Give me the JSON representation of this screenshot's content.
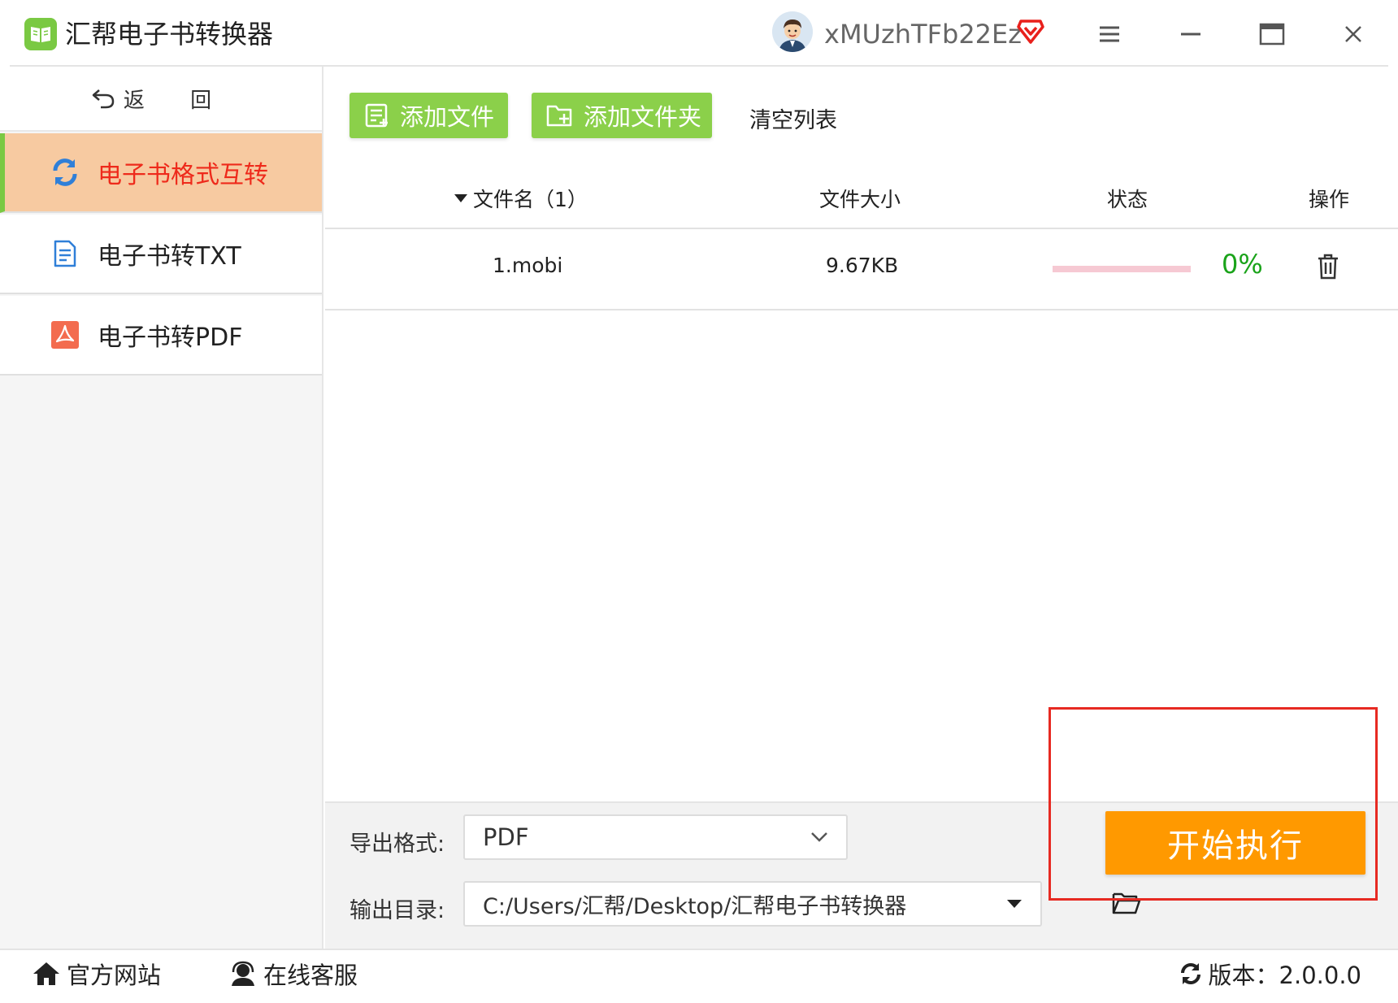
{
  "app": {
    "title": "汇帮电子书转换器",
    "username": "xMUzhTFb22Ez"
  },
  "sidebar": {
    "back_label": "返 回",
    "items": [
      {
        "label": "电子书格式互转",
        "active": true,
        "icon": "refresh-icon"
      },
      {
        "label": "电子书转TXT",
        "active": false,
        "icon": "document-icon"
      },
      {
        "label": "电子书转PDF",
        "active": false,
        "icon": "pdf-icon"
      }
    ]
  },
  "toolbar": {
    "add_file": "添加文件",
    "add_folder": "添加文件夹",
    "clear_list": "清空列表"
  },
  "table": {
    "headers": {
      "filename": "文件名（1）",
      "size": "文件大小",
      "status": "状态",
      "action": "操作"
    },
    "rows": [
      {
        "filename": "1.mobi",
        "size": "9.67KB",
        "progress": "0%"
      }
    ]
  },
  "output": {
    "format_label": "导出格式:",
    "format_value": "PDF",
    "dir_label": "输出目录:",
    "dir_value": "C:/Users/汇帮/Desktop/汇帮电子书转换器"
  },
  "start_button": "开始执行",
  "footer": {
    "website": "官方网站",
    "support": "在线客服",
    "version": "版本：2.0.0.0"
  },
  "colors": {
    "accent_green": "#7ac943",
    "start_orange": "#ff9900",
    "active_bg": "#f7caa1",
    "active_text": "#ee2a1b",
    "progress_text": "#1aa31a"
  }
}
